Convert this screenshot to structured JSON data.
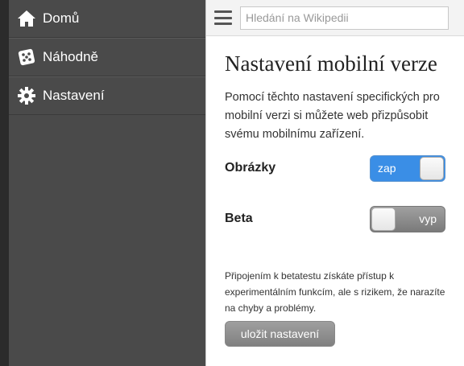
{
  "sidebar": {
    "items": [
      {
        "label": "Domů",
        "icon": "home-icon"
      },
      {
        "label": "Náhodně",
        "icon": "dice-icon"
      },
      {
        "label": "Nastavení",
        "icon": "gear-icon"
      }
    ]
  },
  "header": {
    "menu_icon": "hamburger-menu-icon",
    "search_placeholder": "Hledání na Wikipedii"
  },
  "settings": {
    "title": "Nastavení mobilní verze",
    "description": "Pomocí těchto nastavení specifických pro mobilní verzi si můžete web přizpůsobit svému mobilnímu zařízení.",
    "images": {
      "label": "Obrázky",
      "state": "zap"
    },
    "beta": {
      "label": "Beta",
      "state": "vyp"
    },
    "beta_note": "Připojením k betatestu získáte přístup k experimentálním funkcím, ale s rizikem, že narazíte na chyby a problémy.",
    "save_label": "uložit nastavení"
  },
  "colors": {
    "toggle_on": "#3a8ee6",
    "sidebar_bg": "#4a4a4a"
  }
}
